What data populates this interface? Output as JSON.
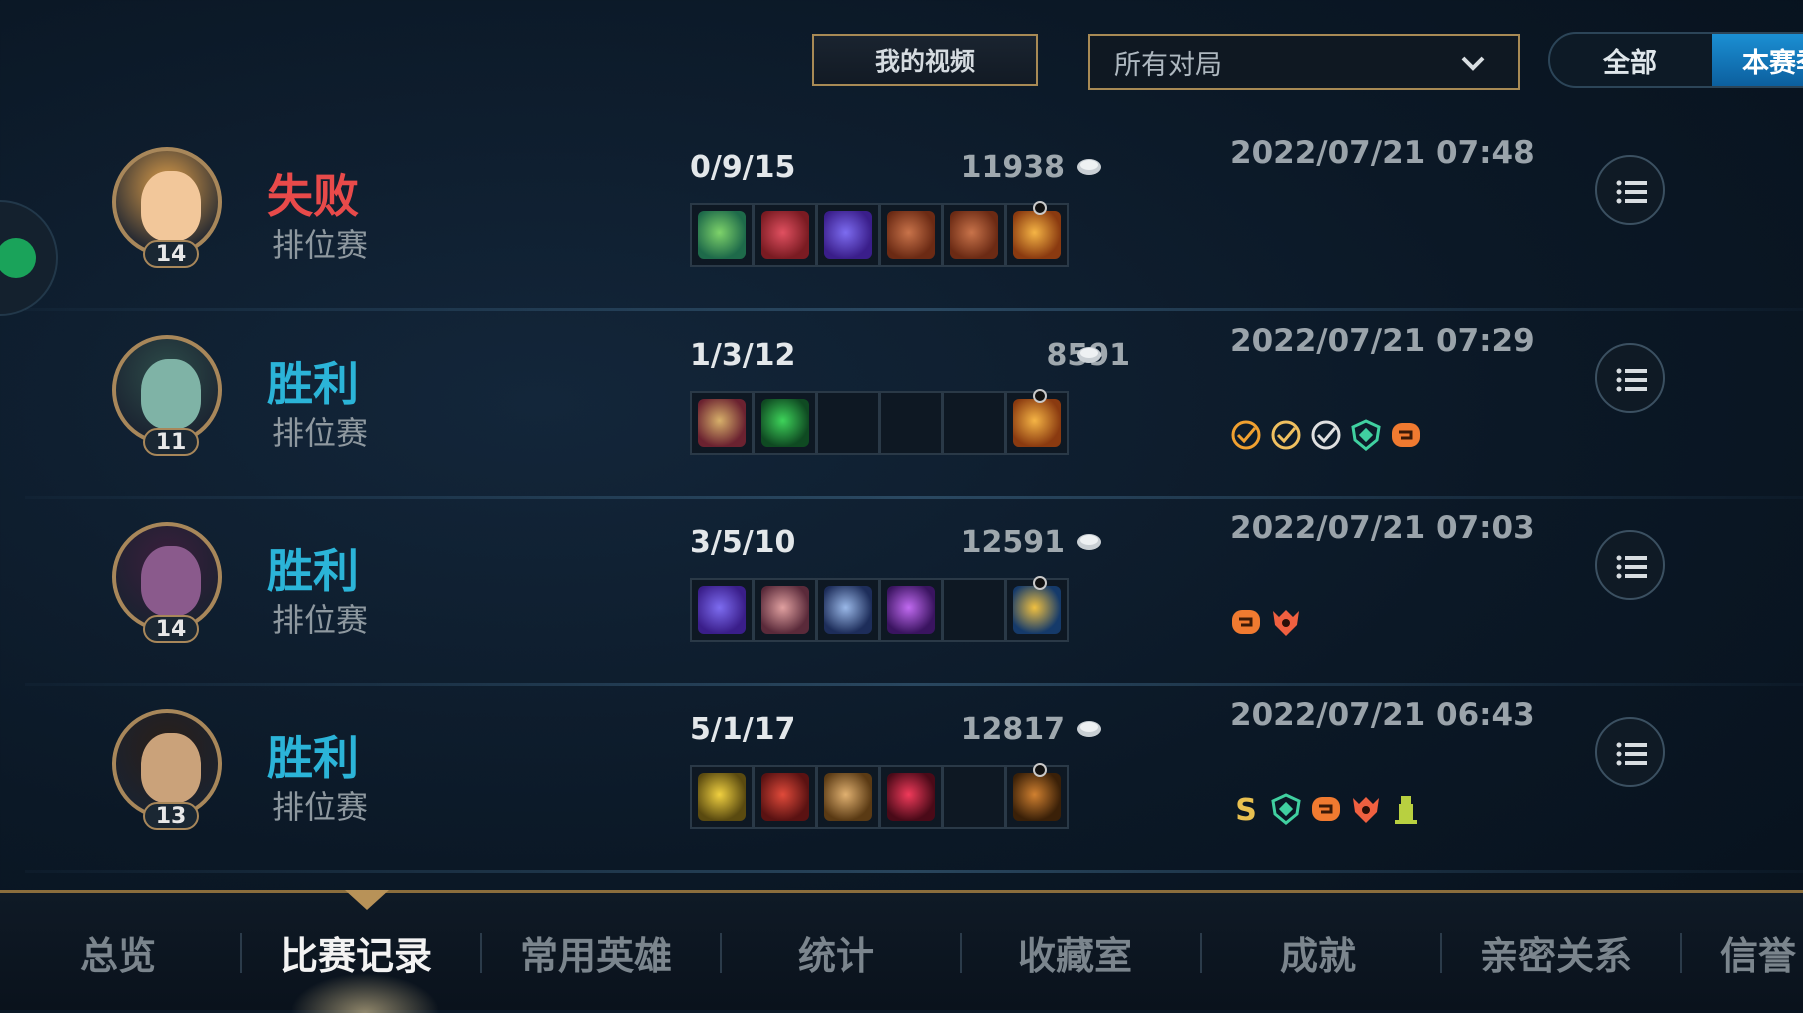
{
  "toolbar": {
    "my_videos_label": "我的视频",
    "filter_value": "所有对局",
    "season_tabs": [
      "全部",
      "本赛季"
    ]
  },
  "colors": {
    "win": "#2bb4d8",
    "loss": "#e84a4a",
    "gold_border": "#a8875a",
    "active_tab_bg": "#1b8fd3"
  },
  "matches": [
    {
      "result": "失败",
      "result_type": "loss",
      "mode": "排位赛",
      "level": "14",
      "kda": "0/9/15",
      "gold": "11938",
      "date": "2022/07/21 07:48",
      "items": [
        "green-staff-icon",
        "red-claw-icon",
        "purple-wand-icon",
        "tome-icon",
        "tome-icon",
        "golden-star-trinket-icon"
      ],
      "badges": []
    },
    {
      "result": "胜利",
      "result_type": "win",
      "mode": "排位赛",
      "level": "11",
      "kda": "1/3/12",
      "gold": "8591",
      "date": "2022/07/21 07:29",
      "items": [
        "armor-chest-icon",
        "green-orb-icon",
        "",
        "",
        "",
        "golden-star-trinket-icon"
      ],
      "badges": [
        "assist-badge-icon",
        "support-badge-icon",
        "vision-badge-icon",
        "shield-badge-icon",
        "chain-badge-icon"
      ]
    },
    {
      "result": "胜利",
      "result_type": "win",
      "mode": "排位赛",
      "level": "14",
      "kda": "3/5/10",
      "gold": "12591",
      "date": "2022/07/21 07:03",
      "items": [
        "purple-wand-icon",
        "red-helmet-icon",
        "crystal-shard-icon",
        "purple-gem-icon",
        "",
        "blue-lantern-trinket-icon"
      ],
      "badges": [
        "chain-badge-icon",
        "demon-badge-icon"
      ]
    },
    {
      "result": "胜利",
      "result_type": "win",
      "mode": "排位赛",
      "level": "13",
      "kda": "5/1/17",
      "gold": "12817",
      "date": "2022/07/21 06:43",
      "items": [
        "yellow-triangle-icon",
        "red-gauntlet-icon",
        "gold-gauntlet-icon",
        "ruby-gem-icon",
        "",
        "skull-trinket-icon"
      ],
      "badges": [
        "s-rank-badge-icon",
        "shield-badge-icon",
        "chain-badge-icon",
        "demon-badge-icon",
        "tower-badge-icon"
      ]
    }
  ],
  "bottom_tabs": [
    "总览",
    "比赛记录",
    "常用英雄",
    "统计",
    "收藏室",
    "成就",
    "亲密关系",
    "信誉"
  ],
  "active_tab": "比赛记录"
}
